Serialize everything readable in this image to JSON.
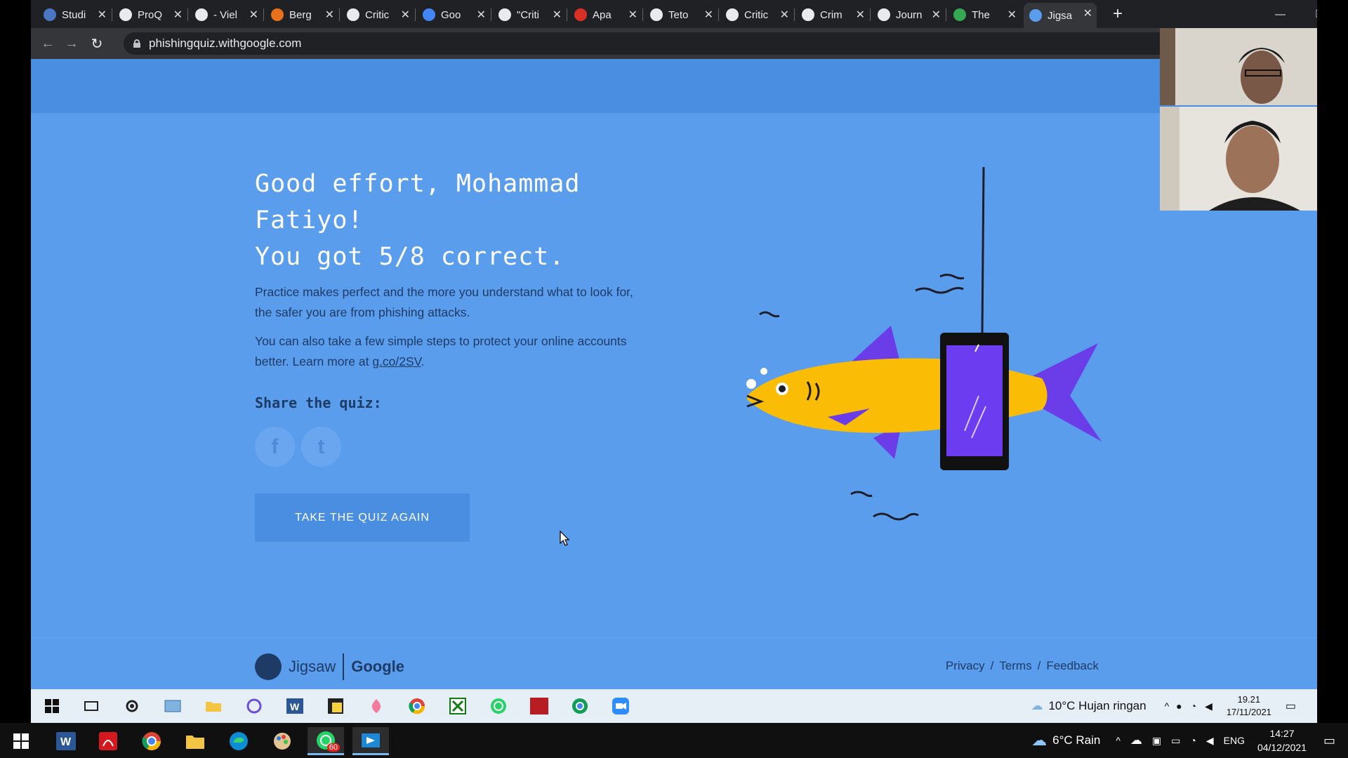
{
  "browser": {
    "tabs": [
      {
        "title": "Studi",
        "icon": "student-icon",
        "color": "#4a76c4"
      },
      {
        "title": "ProQ",
        "icon": "globe-icon",
        "color": "#e8eaed"
      },
      {
        "title": "- Viel",
        "icon": "document-icon",
        "color": "#e8eaed"
      },
      {
        "title": "Berg",
        "icon": "berg-icon",
        "color": "#e8711c"
      },
      {
        "title": "Critic",
        "icon": "w-icon",
        "color": "#e8eaed"
      },
      {
        "title": "Goo",
        "icon": "google-translate-icon",
        "color": "#4285f4"
      },
      {
        "title": "\"Criti",
        "icon": "globe-icon",
        "color": "#e8eaed"
      },
      {
        "title": "Apa",
        "icon": "circle-icon",
        "color": "#d93025"
      },
      {
        "title": "Teto",
        "icon": "globe-icon",
        "color": "#e8eaed"
      },
      {
        "title": "Critic",
        "icon": "wikipedia-icon",
        "color": "#e8eaed"
      },
      {
        "title": "Crim",
        "icon": "academic-icon",
        "color": "#e8eaed"
      },
      {
        "title": "Journ",
        "icon": "globe-icon",
        "color": "#e8eaed"
      },
      {
        "title": "The",
        "icon": "green-icon",
        "color": "#34a853"
      },
      {
        "title": "Jigsa",
        "icon": "jigsaw-tab-icon",
        "color": "#5b9ded",
        "active": true
      }
    ],
    "url": "phishingquiz.withgoogle.com"
  },
  "page": {
    "title_lines": [
      "Good effort, Mohammad",
      "Fatiyo!",
      "You got 5/8 correct."
    ],
    "para1": "Practice makes perfect and the more you understand what to look for, the safer you are from phishing attacks.",
    "para2_prefix": "You can also take a few simple steps to protect your online accounts better. Learn more at ",
    "para2_link": "g.co/2SV",
    "para2_suffix": ".",
    "share_label": "Share the quiz:",
    "share_facebook": "f",
    "share_twitter": "t",
    "retake_label": "TAKE THE QUIZ AGAIN",
    "footer": {
      "jigsaw": "Jigsaw",
      "google": "Google",
      "links": [
        "Privacy",
        "/",
        "Terms",
        "/",
        "Feedback"
      ]
    }
  },
  "inner_taskbar": {
    "weather": "10°C  Hujan ringan",
    "time": "19.21",
    "date": "17/11/2021"
  },
  "taskbar": {
    "whatsapp_badge": "60",
    "weather": "6°C  Rain",
    "lang": "ENG",
    "time": "14:27",
    "date": "04/12/2021"
  },
  "colors": {
    "page_bg": "#5b9ded",
    "header_bg": "#4a8ee2",
    "text_dark": "#1e3b66",
    "fish_yellow": "#fbbc05",
    "fish_fin": "#6a3de8",
    "phone_screen": "#6b3cf0"
  }
}
